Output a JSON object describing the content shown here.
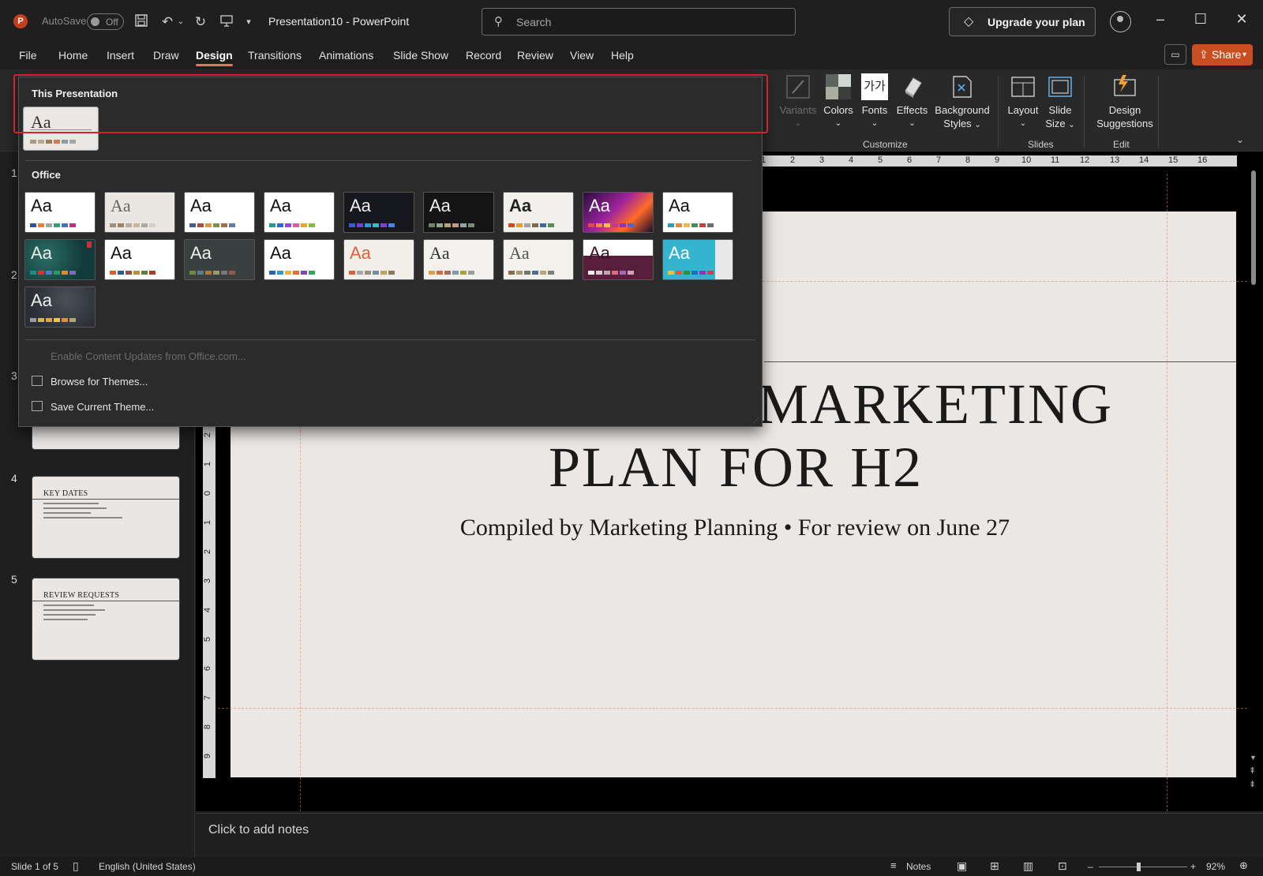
{
  "app": {
    "logo_letter": "P",
    "autosave_label": "AutoSave",
    "autosave_state": "Off",
    "document_title": "Presentation10  -  PowerPoint",
    "search_placeholder": "Search",
    "upgrade_label": "Upgrade your plan",
    "share_label": "Share"
  },
  "menu_tabs": [
    "File",
    "Home",
    "Insert",
    "Draw",
    "Design",
    "Transitions",
    "Animations",
    "Slide Show",
    "Record",
    "Review",
    "View",
    "Help"
  ],
  "active_tab": "Design",
  "ribbon": {
    "variants_label": "Variants",
    "colors_label": "Colors",
    "fonts_label": "Fonts",
    "fonts_glyph": "가가",
    "effects_label": "Effects",
    "background_label_1": "Background",
    "background_label_2": "Styles",
    "layout_label": "Layout",
    "slide_size_label_1": "Slide",
    "slide_size_label_2": "Size",
    "design_label_1": "Design",
    "design_label_2": "Suggestions",
    "group_customize": "Customize",
    "group_slides": "Slides",
    "group_edit": "Edit"
  },
  "theme_dropdown": {
    "section_this": "This Presentation",
    "section_office": "Office",
    "theme_sample": "Aa",
    "enable_updates": "Enable Content Updates from Office.com...",
    "browse_themes": "Browse for Themes...",
    "save_theme": "Save Current Theme..."
  },
  "slides_panel": {
    "numbers": [
      "1",
      "2",
      "3",
      "4",
      "5"
    ],
    "slide4_title": "KEY DATES",
    "slide5_title": "REVIEW REQUESTS"
  },
  "slide": {
    "title_line1": "MARKETING",
    "title_line2": "PLAN FOR H2",
    "subtitle": "Compiled by Marketing Planning • For review on June 27"
  },
  "rulers": {
    "top": [
      "1",
      "2",
      "3",
      "4",
      "5",
      "6",
      "7",
      "8",
      "9",
      "10",
      "11",
      "12",
      "13",
      "14",
      "15",
      "16"
    ],
    "left": [
      "2",
      "1",
      "0",
      "1",
      "2",
      "3",
      "4",
      "5",
      "6",
      "7",
      "8",
      "9"
    ]
  },
  "notes_placeholder": "Click to add notes",
  "status": {
    "slide_info": "Slide 1 of 5",
    "language": "English (United States)",
    "notes_label": "Notes",
    "zoom": "92%"
  },
  "colors": {
    "accent": "#e07a5f",
    "share_bg": "#c94f23",
    "highlight_border": "#d6232a"
  }
}
